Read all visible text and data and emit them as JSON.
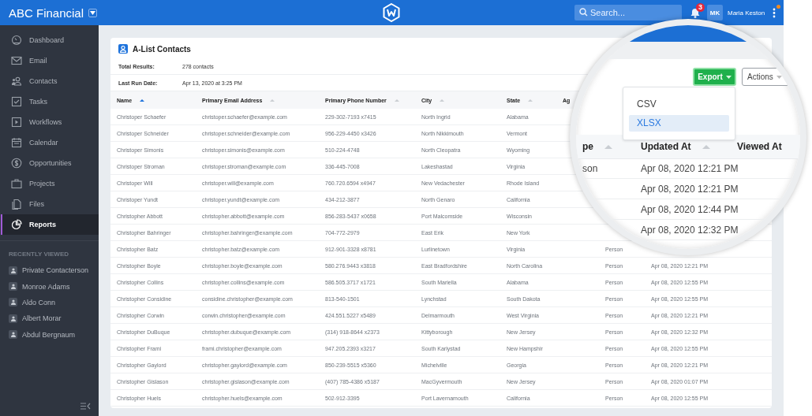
{
  "app": {
    "title": "ABC Financial"
  },
  "topbar": {
    "search": {
      "placeholder": "Search..."
    },
    "notifications": "3",
    "user": {
      "initials": "MK",
      "name": "Maria Keston"
    }
  },
  "sidebar": {
    "items": [
      {
        "label": "Dashboard",
        "selected": false
      },
      {
        "label": "Email",
        "selected": false
      },
      {
        "label": "Contacts",
        "selected": false
      },
      {
        "label": "Tasks",
        "selected": false
      },
      {
        "label": "Workflows",
        "selected": false
      },
      {
        "label": "Calendar",
        "selected": false
      },
      {
        "label": "Opportunities",
        "selected": false
      },
      {
        "label": "Projects",
        "selected": false
      },
      {
        "label": "Files",
        "selected": false
      },
      {
        "label": "Reports",
        "selected": true
      }
    ],
    "recent_heading": "RECENTLY VIEWED",
    "recent": [
      "Private Contacterson",
      "Monroe Adams",
      "Aldo Conn",
      "Albert Morar",
      "Abdul Bergnaum"
    ]
  },
  "report": {
    "title": "A-List Contacts",
    "info": [
      {
        "label": "Total Results:",
        "value": "278 contacts"
      },
      {
        "label": "Last Run Date:",
        "value": "Apr 13, 2020 at 3:25 PM"
      }
    ],
    "columns": [
      {
        "label": "Name",
        "sorted": true
      },
      {
        "label": "Primary Email Address",
        "sorted": false
      },
      {
        "label": "Primary Phone Number",
        "sorted": false
      },
      {
        "label": "City",
        "sorted": false
      },
      {
        "label": "State",
        "sorted": false
      },
      {
        "label": "Ag"
      }
    ],
    "rows": [
      {
        "name": "Christoper Schaefer",
        "email": "christoper.schaefer@example.com",
        "phone": "229-302-7193 x7415",
        "city": "North Ingrid",
        "state": "Alabama"
      },
      {
        "name": "Christoper Schneider",
        "email": "christoper.schneider@example.com",
        "phone": "956-229-4450 x3426",
        "city": "North Nikkimouth",
        "state": "Vermont"
      },
      {
        "name": "Christoper Simonis",
        "email": "christoper.simonis@example.com",
        "phone": "510-224-4748",
        "city": "North Cleopatra",
        "state": "Wyoming"
      },
      {
        "name": "Christoper Stroman",
        "email": "christoper.stroman@example.com",
        "phone": "336-445-7008",
        "city": "Lakeshastad",
        "state": "Virginia"
      },
      {
        "name": "Christoper Will",
        "email": "christoper.will@example.com",
        "phone": "760.720.6594 x4947",
        "city": "New Vedachester",
        "state": "Rhode Island"
      },
      {
        "name": "Christoper Yundt",
        "email": "christoper.yundt@example.com",
        "phone": "434-212-3877",
        "city": "North Genaro",
        "state": "California"
      },
      {
        "name": "Christopher Abbott",
        "email": "christopher.abbott@example.com",
        "phone": "856-283-5437 x0658",
        "city": "Port Malcomside",
        "state": "Wisconsin"
      },
      {
        "name": "Christopher Bahringer",
        "email": "christopher.bahringer@example.com",
        "phone": "704-772-2979",
        "city": "East Erik",
        "state": "New York"
      },
      {
        "name": "Christopher Batz",
        "email": "christopher.batz@example.com",
        "phone": "912-901-3328 x8781",
        "city": "Lurlinetown",
        "state": "Virginia",
        "type": "Person"
      },
      {
        "name": "Christopher Boyle",
        "email": "christopher.boyle@example.com",
        "phone": "580.276.9443 x3818",
        "city": "East Bradfordshire",
        "state": "North Carolina",
        "type": "Person",
        "updated": "Apr 08, 2020 12:21 PM"
      },
      {
        "name": "Christopher Collins",
        "email": "christopher.collins@example.com",
        "phone": "586.505.3717 x1721",
        "city": "South Mariella",
        "state": "Alabama",
        "type": "Person",
        "updated": "Apr 08, 2020 12:55 PM"
      },
      {
        "name": "Christopher Considine",
        "email": "considine.christopher@example.com",
        "phone": "813-540-1501",
        "city": "Lynchstad",
        "state": "South Dakota",
        "type": "Person",
        "updated": "Apr 08, 2020 12:55 PM"
      },
      {
        "name": "Christopher Corwin",
        "email": "corwin.christopher@example.com",
        "phone": "424.551.5227 x5489",
        "city": "Delmarmouth",
        "state": "West Virginia",
        "type": "Person",
        "updated": "Apr 08, 2020 12:21 PM"
      },
      {
        "name": "Christopher DuBuque",
        "email": "christopher.dubuque@example.com",
        "phone": "(314) 918-8644 x2373",
        "city": "Kittyborough",
        "state": "New Jersey",
        "type": "Person",
        "updated": "Apr 08, 2020 12:32 PM"
      },
      {
        "name": "Christopher Frami",
        "email": "frami.christopher@example.com",
        "phone": "947.205.2393 x3217",
        "city": "South Karlystad",
        "state": "New Hampshir",
        "type": "Person",
        "updated": "Apr 08, 2020 12:55 PM"
      },
      {
        "name": "Christopher Gaylord",
        "email": "christopher.gaylord@example.com",
        "phone": "850-239-5515 x5360",
        "city": "Michelville",
        "state": "Georgia",
        "type": "Person",
        "updated": "Apr 08, 2020 12:21 PM"
      },
      {
        "name": "Christopher Gislason",
        "email": "christopher.gislason@example.com",
        "phone": "(407) 785-4386 x5187",
        "city": "MacGyvermouth",
        "state": "New Jersey",
        "type": "Person",
        "updated": "Apr 08, 2020 01:07 PM"
      },
      {
        "name": "Christopher Huels",
        "email": "christopher.huels@example.com",
        "phone": "502-912-3395",
        "city": "Port Lavernamouth",
        "state": "California",
        "type": "Person",
        "updated": "Apr 08, 2020 12:55 PM"
      }
    ]
  },
  "magnifier": {
    "export_button": "Export",
    "actions_button": "Actions",
    "export_menu": [
      {
        "label": "CSV",
        "selected": false
      },
      {
        "label": "XLSX",
        "selected": true
      }
    ],
    "columns": [
      {
        "label": "pe",
        "sortable": true
      },
      {
        "label": "Updated At",
        "sortable": true
      },
      {
        "label": "Viewed At",
        "sortable": false
      }
    ],
    "rows": [
      {
        "type": "son",
        "updated": "Apr 08, 2020 12:21 PM"
      },
      {
        "updated": "Apr 08, 2020 12:21 PM"
      },
      {
        "updated": "Apr 08, 2020 12:44 PM"
      },
      {
        "updated": "Apr 08, 2020 12:32 PM"
      }
    ]
  }
}
